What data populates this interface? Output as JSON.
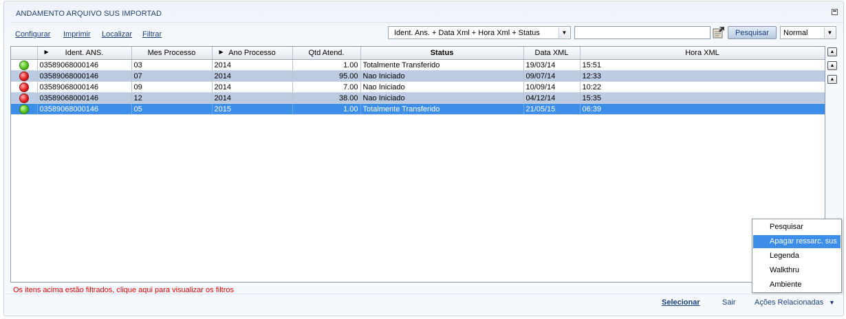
{
  "panel": {
    "title": "ANDAMENTO ARQUIVO SUS IMPORTAD"
  },
  "toolbar": {
    "links": [
      "Configurar",
      "Imprimir",
      "Localizar",
      "Filtrar"
    ],
    "index_order": "Ident. Ans. + Data Xml + Hora Xml + Status",
    "search_value": "",
    "search_button": "Pesquisar",
    "view_mode": "Normal"
  },
  "grid": {
    "columns": [
      "",
      "Ident. ANS.",
      "Mes Processo",
      "Ano Processo",
      "Qtd Atend.",
      "Status",
      "Data XML",
      "Hora XML"
    ],
    "rows": [
      {
        "legend": "green",
        "ident": "03589068000146",
        "mes": "03",
        "ano": "2014",
        "qtd": "1.00",
        "status": "Totalmente Transferido",
        "data": "19/03/14",
        "hora": "15:51"
      },
      {
        "legend": "red",
        "ident": "03589068000146",
        "mes": "07",
        "ano": "2014",
        "qtd": "95.00",
        "status": "Nao Iniciado",
        "data": "09/07/14",
        "hora": "12:33"
      },
      {
        "legend": "red",
        "ident": "03589068000146",
        "mes": "09",
        "ano": "2014",
        "qtd": "7.00",
        "status": "Nao Iniciado",
        "data": "10/09/14",
        "hora": "10:22"
      },
      {
        "legend": "red",
        "ident": "03589068000146",
        "mes": "12",
        "ano": "2014",
        "qtd": "38.00",
        "status": "Nao Iniciado",
        "data": "04/12/14",
        "hora": "15:35"
      },
      {
        "legend": "green",
        "ident": "03589068000146",
        "mes": "05",
        "ano": "2015",
        "qtd": "1.00",
        "status": "Totalmente Transferido",
        "data": "21/05/15",
        "hora": "06:39"
      }
    ],
    "selected_row": 4
  },
  "filter_message": "Os itens acima estão filtrados, clique aqui para visualizar os filtros",
  "footer": {
    "select": "Selecionar",
    "exit": "Sair",
    "related_actions": "Ações Relacionadas"
  },
  "related_menu": {
    "items": [
      "Pesquisar",
      "Apagar ressarc. sus",
      "Legenda",
      "Walkthru",
      "Ambiente"
    ],
    "active_index": 1
  },
  "colors": {
    "selected_row": "#3d8ee9",
    "alt_row": "#bccbe1",
    "legend_green": "#56c41f",
    "legend_red": "#e62121",
    "filter_message": "#e00000"
  }
}
